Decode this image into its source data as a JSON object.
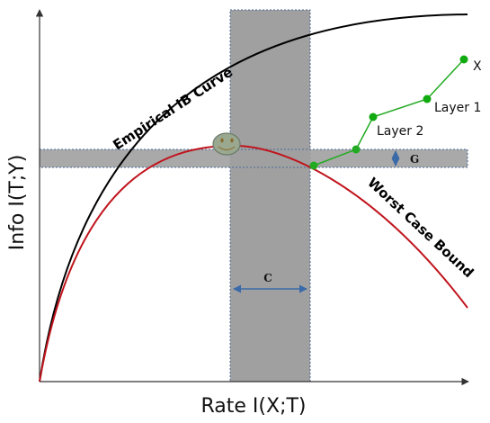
{
  "axes": {
    "x_title": "Rate I(X;T)",
    "y_title": "Info I(T;Y)"
  },
  "curves": {
    "empirical_label": "Empirical IB Curve",
    "worst_case_label": "Worst Case Bound"
  },
  "points": {
    "x_label": "X",
    "layer1_label": "Layer 1",
    "layer2_label": "Layer 2"
  },
  "bands": {
    "c_label": "C",
    "g_label": "G"
  },
  "colors": {
    "empirical_curve": "#000000",
    "worst_case_curve": "#c0141c",
    "band_fill": "#a0a0a0",
    "band_border": "#4a6a9a",
    "layer_path": "#22aa22",
    "arrow": "#3a6aa8"
  },
  "icons": {
    "peak_marker": "smiley-face-icon"
  }
}
